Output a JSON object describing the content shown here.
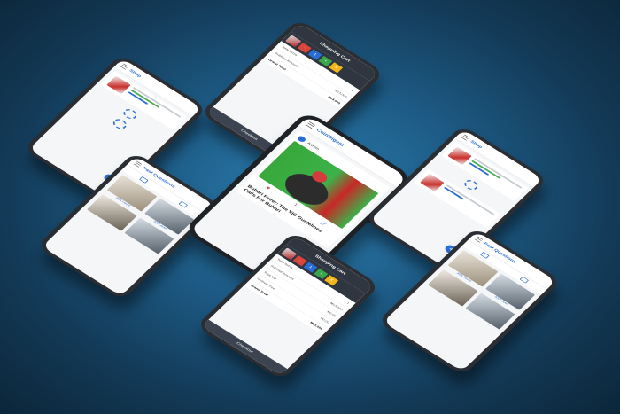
{
  "shop_screen": {
    "title": "Shop",
    "fab": "+"
  },
  "cart_screen": {
    "title": "Shopping Cart",
    "qty_buttons": [
      "-",
      "1",
      "+",
      "X"
    ],
    "lines": [
      {
        "label": "Total Items",
        "value": "1"
      },
      {
        "label": "Subtotal Amount",
        "value": "₦13,000"
      },
      {
        "label": "Total Vat",
        "value": "₦0.00"
      },
      {
        "label": "Delivery Fee",
        "value": "₦0.00"
      }
    ],
    "grand_total_label": "Grand Total",
    "grand_total_value": "₦13,000",
    "checkout_label": "Checkout"
  },
  "past_questions_screen": {
    "title": "Past Questions",
    "captions": [
      "JSS Level",
      "SS Level"
    ]
  },
  "news_screen": {
    "title": "CoinDigest",
    "post_author": "Admin",
    "headline": "Buhari Fever: The VIC Guidelines Calls For Buhari",
    "likes": "1"
  },
  "colors": {
    "accent": "#2b6dd6",
    "dark_bar": "#2f3640",
    "red": "#d9453b",
    "green": "#3aa64a",
    "yellow": "#f3b51b"
  }
}
